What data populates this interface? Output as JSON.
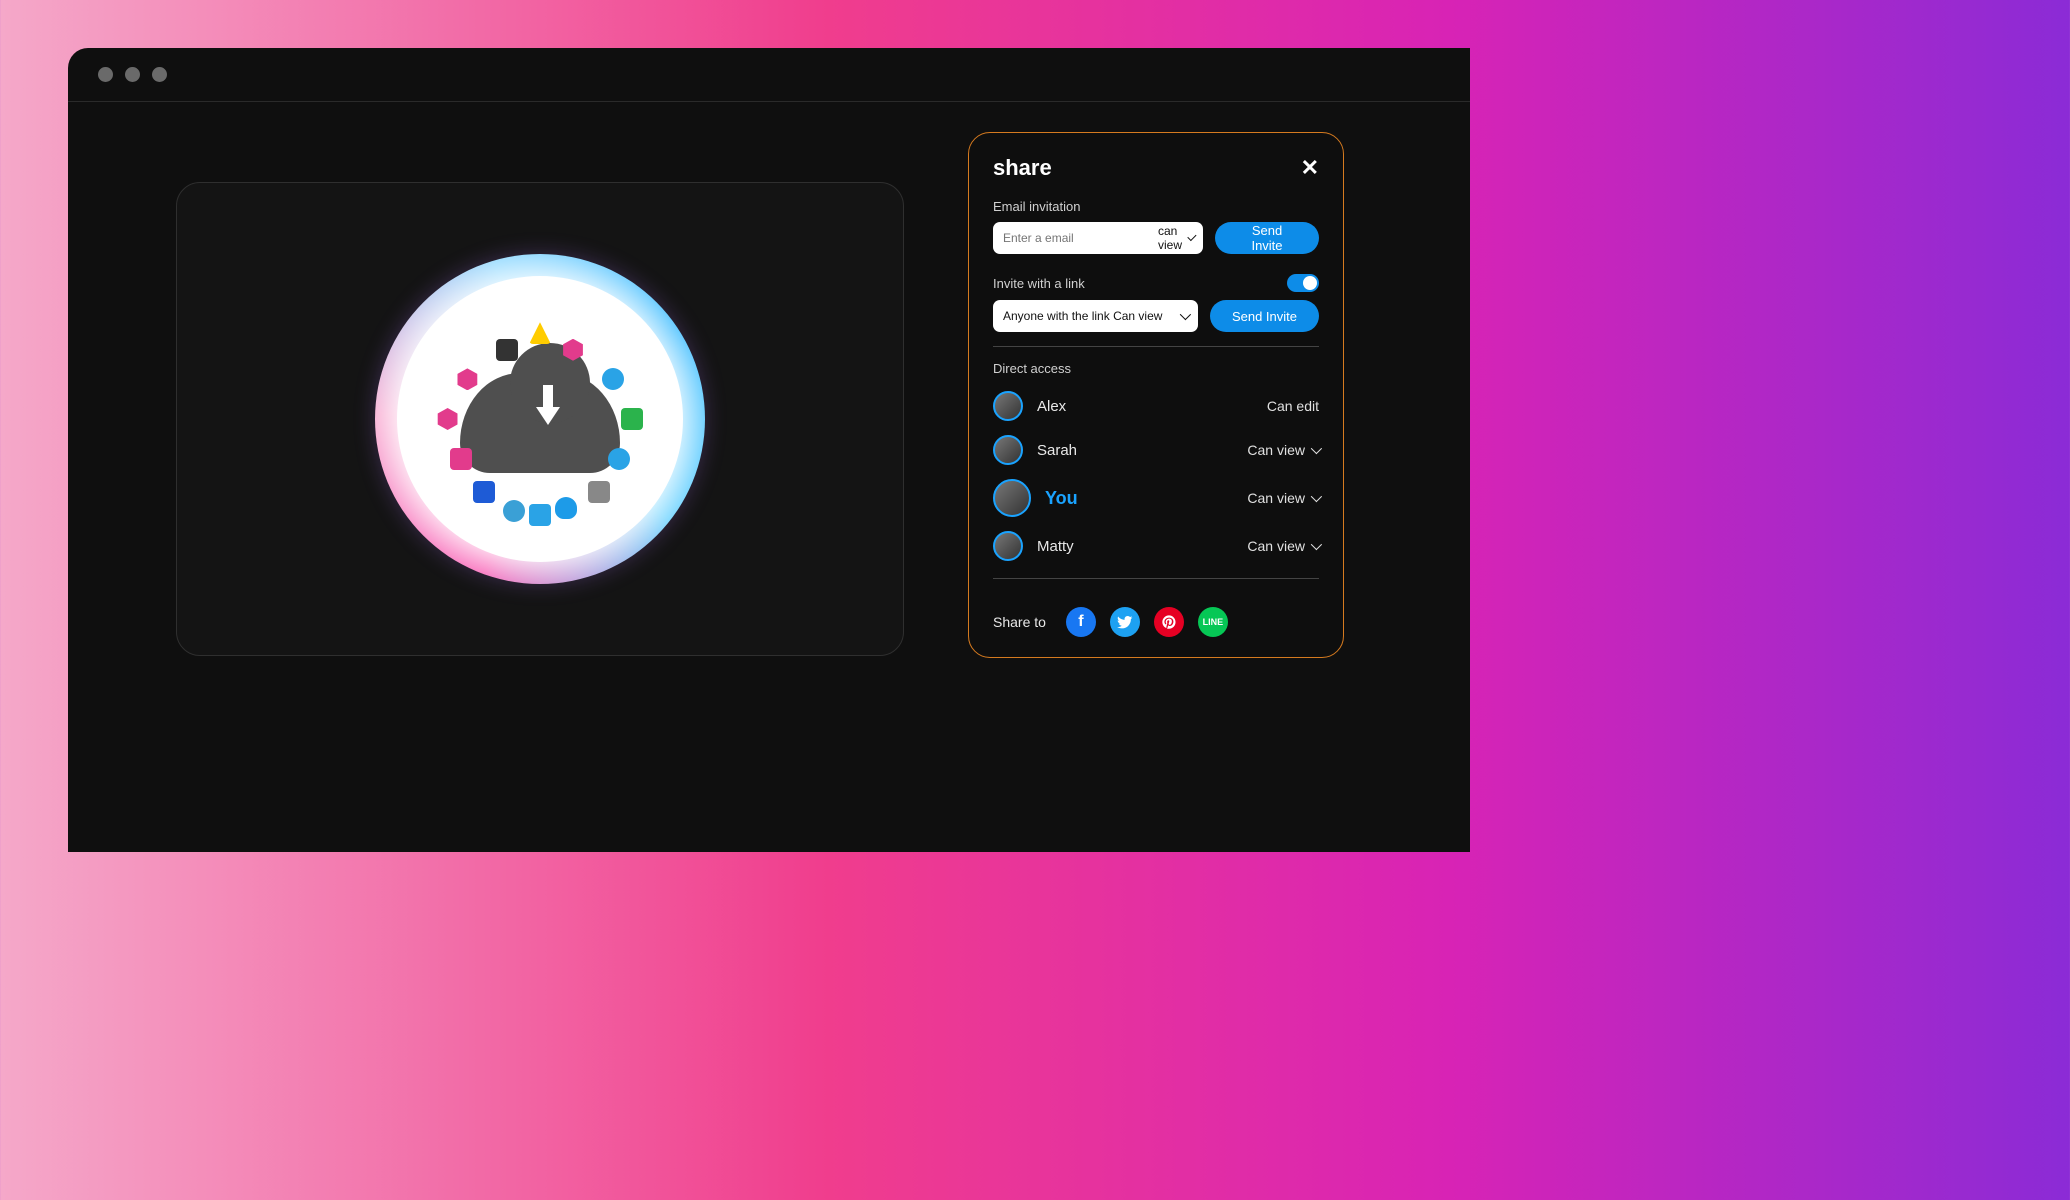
{
  "share": {
    "title": "share",
    "email_section": "Email invitation",
    "email_placeholder": "Enter a email",
    "email_perm": "can view",
    "send_btn": "Send Invite",
    "link_section": "Invite with a link",
    "link_option": "Anyone with the link Can view",
    "direct_access": "Direct access",
    "users": [
      {
        "name": "Alex",
        "perm": "Can edit",
        "dropdown": false,
        "you": false
      },
      {
        "name": "Sarah",
        "perm": "Can view",
        "dropdown": true,
        "you": false
      },
      {
        "name": "You",
        "perm": "Can view",
        "dropdown": true,
        "you": true
      },
      {
        "name": "Matty",
        "perm": "Can view",
        "dropdown": true,
        "you": false
      }
    ],
    "share_to": "Share to",
    "socials": [
      "facebook",
      "twitter",
      "pinterest",
      "line"
    ]
  }
}
